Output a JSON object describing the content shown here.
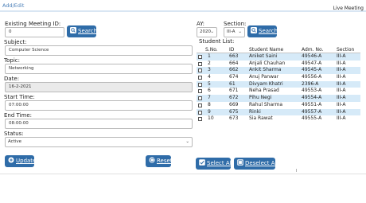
{
  "header": {
    "breadcrumb": "Add/Edit",
    "live_label": "Live Meeting"
  },
  "form": {
    "existing_id_label": "Existing Meeting ID:",
    "existing_id_value": "0",
    "search_label": "Search",
    "subject_label": "Subject:",
    "subject_value": "Computer Science",
    "topic_label": "Topic:",
    "topic_value": "Networking",
    "date_label": "Date:",
    "date_value": "16-2-2021",
    "start_label": "Start Time:",
    "start_value": "07:00:00",
    "end_label": "End Time:",
    "end_value": "08:00:00",
    "status_label": "Status:",
    "status_value": "Active",
    "update_label": "Update",
    "reset_label": "Reset"
  },
  "filters": {
    "ay_label": "AY:",
    "ay_value": "2020",
    "section_label": "Section:",
    "section_value": "III-A",
    "search_label": "Search"
  },
  "students": {
    "title": "Student List:",
    "columns": [
      "S.No.",
      "ID",
      "Student Name",
      "Adm. No.",
      "Section"
    ],
    "rows": [
      {
        "sno": "1",
        "id": "663",
        "name": "Aniket Saini",
        "adm": "49546-A",
        "section": "III-A"
      },
      {
        "sno": "2",
        "id": "664",
        "name": "Anjali Chauhan",
        "adm": "49547-A",
        "section": "III-A"
      },
      {
        "sno": "3",
        "id": "662",
        "name": "Ankit Sharma",
        "adm": "49545-A",
        "section": "III-A"
      },
      {
        "sno": "4",
        "id": "674",
        "name": "Anuj Panwar",
        "adm": "49556-A",
        "section": "III-A"
      },
      {
        "sno": "5",
        "id": "61",
        "name": "Divyam Khatri",
        "adm": "2396-A",
        "section": "III-A"
      },
      {
        "sno": "6",
        "id": "671",
        "name": "Neha Prasad",
        "adm": "49553-A",
        "section": "III-A"
      },
      {
        "sno": "7",
        "id": "672",
        "name": "Pihu Negi",
        "adm": "49554-A",
        "section": "III-A"
      },
      {
        "sno": "8",
        "id": "669",
        "name": "Rahul Sharma",
        "adm": "49551-A",
        "section": "III-A"
      },
      {
        "sno": "9",
        "id": "675",
        "name": "Rinki",
        "adm": "49557-A",
        "section": "III-A"
      },
      {
        "sno": "10",
        "id": "673",
        "name": "Sia Rawat",
        "adm": "49555-A",
        "section": "III-A"
      }
    ],
    "select_all_label": "Select All",
    "deselect_all_label": "Deselect All"
  },
  "icons": {
    "search": "search-icon",
    "update": "plus-circle-icon",
    "reset": "refresh-icon",
    "select_all": "checkbox-checked-icon",
    "deselect_all": "checkbox-unchecked-icon"
  },
  "colors": {
    "button": "#2f6ca8",
    "row_stripe": "#d6eaf8",
    "link": "#4a7fb8"
  }
}
